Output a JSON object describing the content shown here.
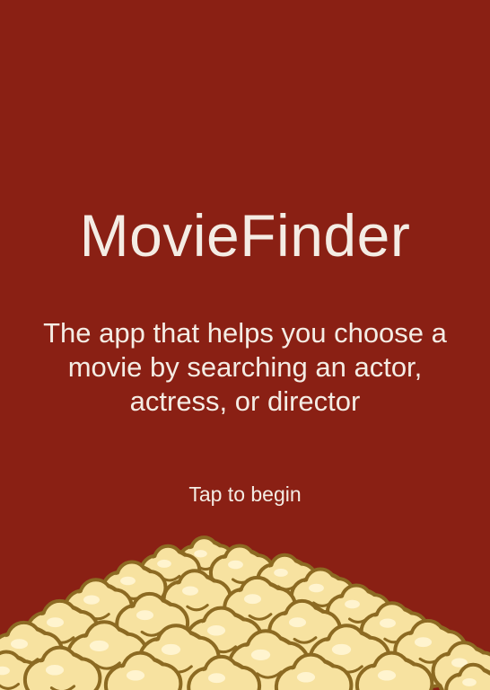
{
  "app": {
    "title": "MovieFinder",
    "tagline": "The app that helps you choose a movie by searching an actor, actress, or director",
    "start_label": "Tap to begin"
  },
  "illustration": {
    "name": "popcorn-illustration"
  },
  "colors": {
    "background": "#8a2014",
    "text": "#f4ece4",
    "popcorn_fill": "#f7e2a0",
    "popcorn_outline": "#8c6a22",
    "popcorn_highlight": "#fff4cf"
  }
}
